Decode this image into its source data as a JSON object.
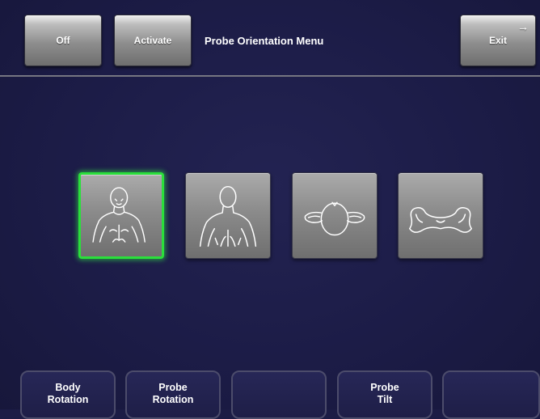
{
  "top_bar": {
    "off_label": "Off",
    "activate_label": "Activate",
    "title": "Probe Orientation Menu",
    "exit_label": "Exit",
    "exit_icon": "arrow-right-icon"
  },
  "orientation_options": [
    {
      "icon": "body-front-icon",
      "selected": true
    },
    {
      "icon": "body-back-icon",
      "selected": false
    },
    {
      "icon": "head-top-icon",
      "selected": false
    },
    {
      "icon": "pelvis-icon",
      "selected": false
    }
  ],
  "soft_keys": [
    {
      "line1": "Body",
      "line2": "Rotation"
    },
    {
      "line1": "Probe",
      "line2": "Rotation"
    },
    {
      "line1": "",
      "line2": ""
    },
    {
      "line1": "Probe",
      "line2": "Tilt"
    },
    {
      "line1": "",
      "line2": ""
    }
  ],
  "colors": {
    "background": "#1c1c45",
    "selection_highlight": "#2adf3b",
    "button_gray": "#8e8e8e"
  }
}
